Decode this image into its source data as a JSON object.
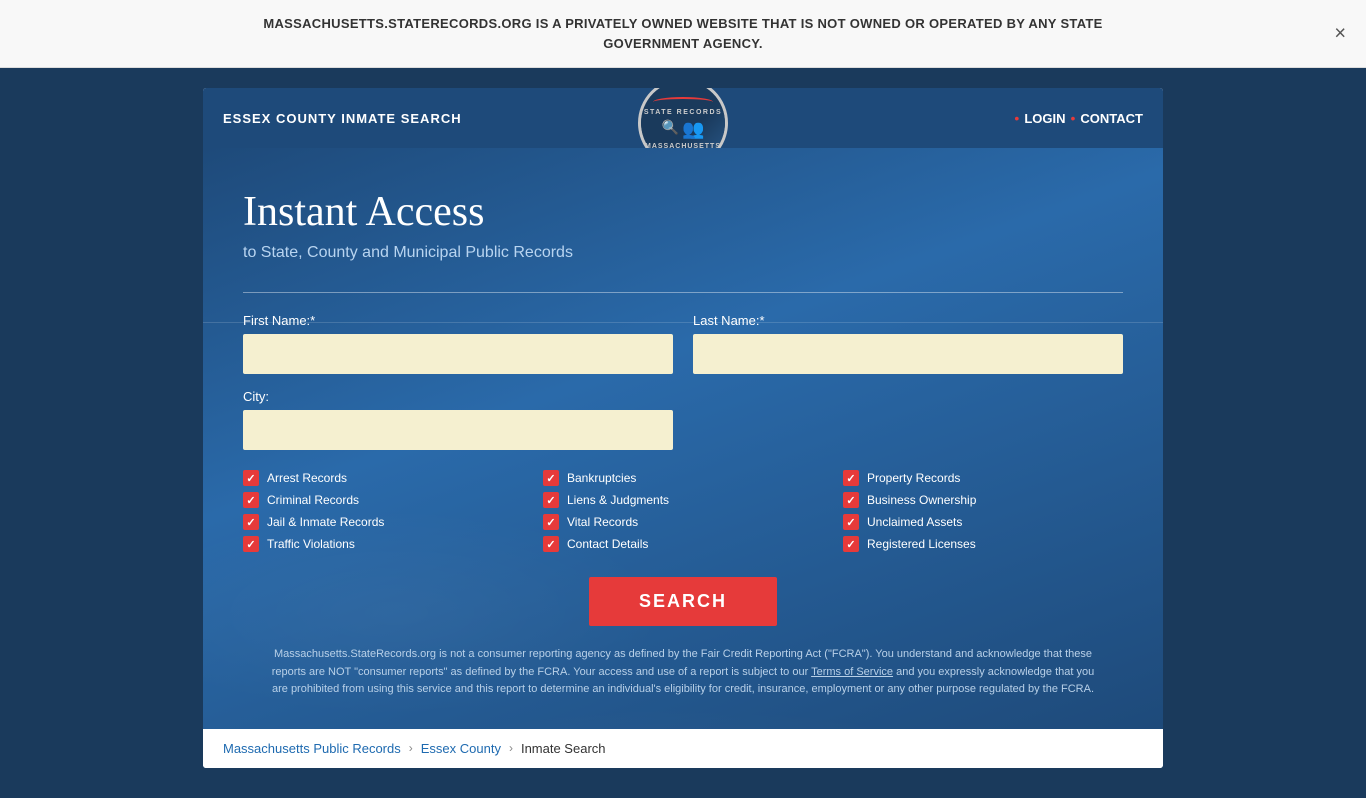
{
  "banner": {
    "text": "MASSACHUSETTS.STATERECORDS.ORG IS A PRIVATELY OWNED WEBSITE THAT IS NOT OWNED OR OPERATED BY ANY STATE GOVERNMENT AGENCY.",
    "close_label": "×"
  },
  "header": {
    "title": "ESSEX COUNTY INMATE SEARCH",
    "nav": {
      "login_label": "LOGIN",
      "contact_label": "CONTACT"
    },
    "logo": {
      "top_text": "STATE RECORDS",
      "bottom_text": "MASSACHUSETTS"
    }
  },
  "hero": {
    "title": "Instant Access",
    "subtitle": "to State, County and Municipal Public Records"
  },
  "form": {
    "first_name_label": "First Name:*",
    "last_name_label": "Last Name:*",
    "city_label": "City:",
    "first_name_placeholder": "",
    "last_name_placeholder": "",
    "city_placeholder": ""
  },
  "checkboxes": {
    "col1": [
      {
        "label": "Arrest Records"
      },
      {
        "label": "Criminal Records"
      },
      {
        "label": "Jail & Inmate Records"
      },
      {
        "label": "Traffic Violations"
      }
    ],
    "col2": [
      {
        "label": "Bankruptcies"
      },
      {
        "label": "Liens & Judgments"
      },
      {
        "label": "Vital Records"
      },
      {
        "label": "Contact Details"
      }
    ],
    "col3": [
      {
        "label": "Property Records"
      },
      {
        "label": "Business Ownership"
      },
      {
        "label": "Unclaimed Assets"
      },
      {
        "label": "Registered Licenses"
      }
    ]
  },
  "search_button": {
    "label": "SEARCH"
  },
  "disclaimer": {
    "text_before_link": "Massachusetts.StateRecords.org is not a consumer reporting agency as defined by the Fair Credit Reporting Act (\"FCRA\"). You understand and acknowledge that these reports are NOT \"consumer reports\" as defined by the FCRA. Your access and use of a report is subject to our ",
    "link_text": "Terms of Service",
    "text_after_link": " and you expressly acknowledge that you are prohibited from using this service and this report to determine an individual's eligibility for credit, insurance, employment or any other purpose regulated by the FCRA."
  },
  "breadcrumb": {
    "home_label": "Massachusetts Public Records",
    "county_label": "Essex County",
    "current_label": "Inmate Search"
  }
}
